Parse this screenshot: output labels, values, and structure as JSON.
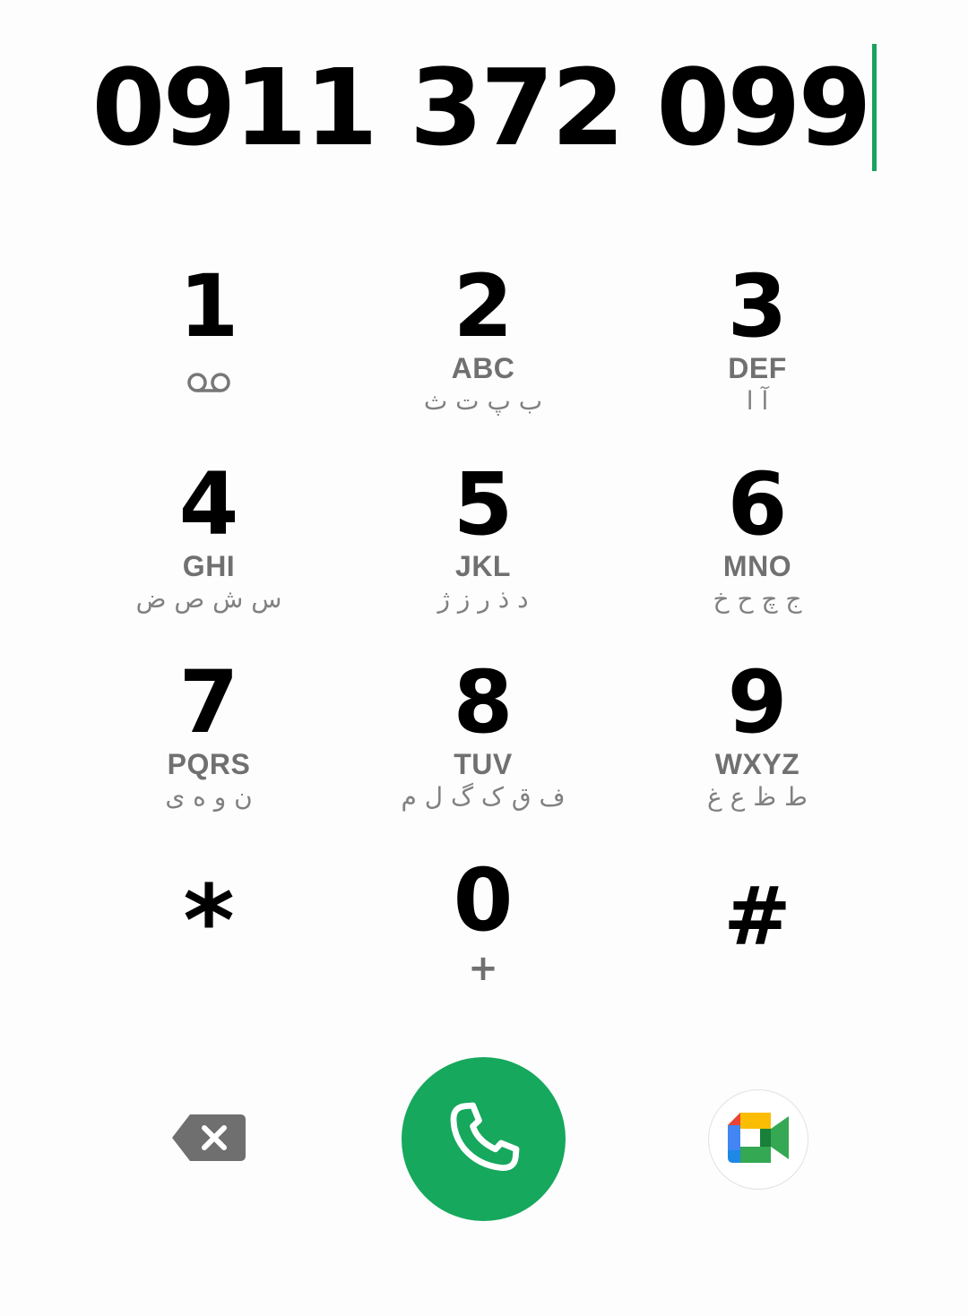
{
  "display": {
    "number": "0911 372 099"
  },
  "keys": [
    {
      "digit": "1",
      "letters": "",
      "farsi": "",
      "icon": "voicemail-icon"
    },
    {
      "digit": "2",
      "letters": "ABC",
      "farsi": "ب پ ت ث"
    },
    {
      "digit": "3",
      "letters": "DEF",
      "farsi": "آ ا"
    },
    {
      "digit": "4",
      "letters": "GHI",
      "farsi": "س ش ص ض"
    },
    {
      "digit": "5",
      "letters": "JKL",
      "farsi": "د ذ ر ز ژ"
    },
    {
      "digit": "6",
      "letters": "MNO",
      "farsi": "ج چ ح خ"
    },
    {
      "digit": "7",
      "letters": "PQRS",
      "farsi": "ن و ه ی"
    },
    {
      "digit": "8",
      "letters": "TUV",
      "farsi": "ف ق ک گ ل م"
    },
    {
      "digit": "9",
      "letters": "WXYZ",
      "farsi": "ط ظ ع غ"
    },
    {
      "digit": "*",
      "letters": "",
      "farsi": ""
    },
    {
      "digit": "0",
      "letters": "",
      "farsi": "",
      "sub": "+"
    },
    {
      "digit": "#",
      "letters": "",
      "farsi": ""
    }
  ],
  "actions": {
    "backspace_icon": "backspace-icon",
    "call_icon": "phone-icon",
    "meet_icon": "google-meet-icon"
  },
  "colors": {
    "accent": "#1aa260",
    "call_button": "#16a85d",
    "secondary_text": "#707070"
  }
}
